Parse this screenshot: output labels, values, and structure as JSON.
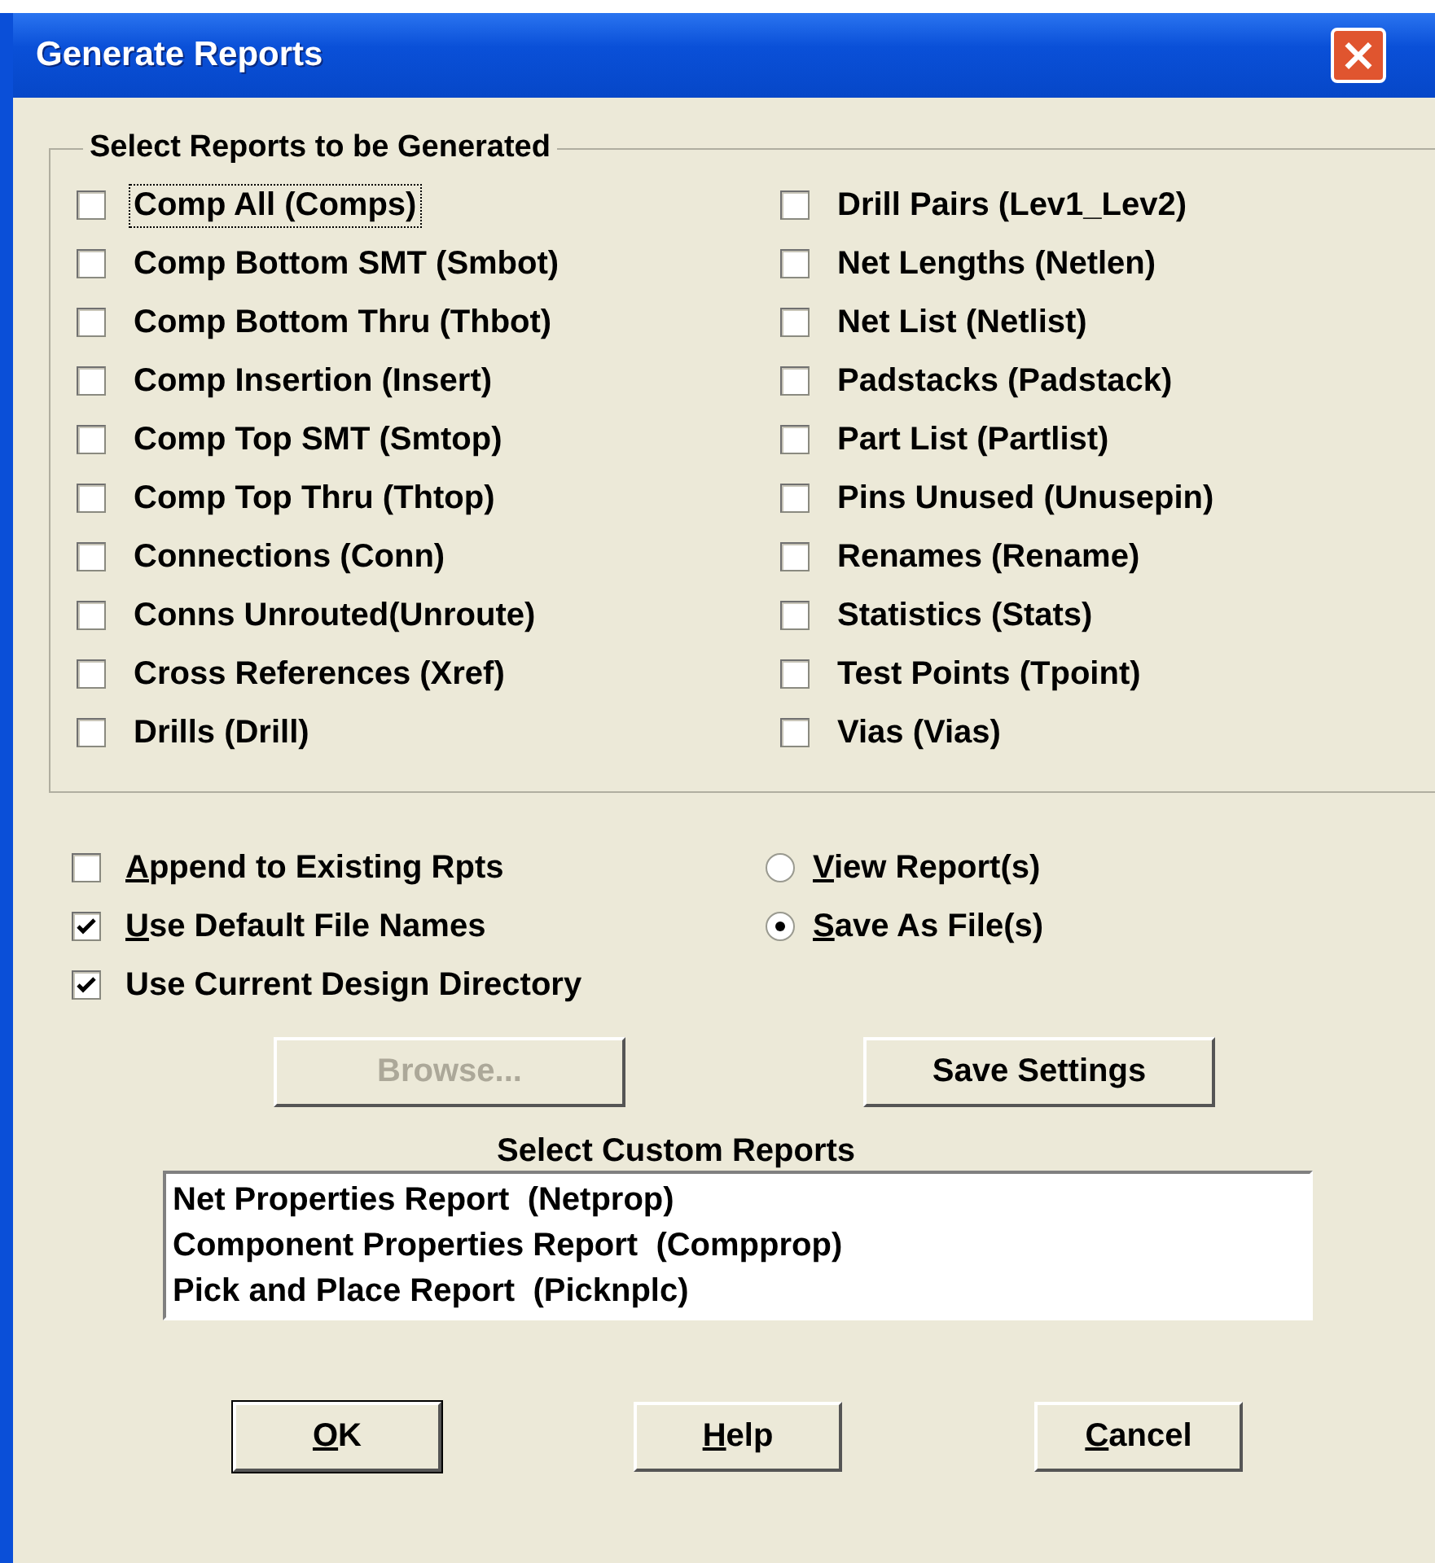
{
  "window": {
    "title": "Generate Reports",
    "close": "×"
  },
  "reports_group": {
    "title": "Select Reports to be Generated",
    "columns": [
      [
        {
          "label": "Comp All (Comps)",
          "checked": false,
          "focused": true
        },
        {
          "label": "Comp Bottom SMT (Smbot)",
          "checked": false,
          "focused": false
        },
        {
          "label": "Comp Bottom Thru (Thbot)",
          "checked": false,
          "focused": false
        },
        {
          "label": "Comp Insertion (Insert)",
          "checked": false,
          "focused": false
        },
        {
          "label": "Comp Top SMT (Smtop)",
          "checked": false,
          "focused": false
        },
        {
          "label": "Comp Top Thru (Thtop)",
          "checked": false,
          "focused": false
        },
        {
          "label": "Connections (Conn)",
          "checked": false,
          "focused": false
        },
        {
          "label": "Conns Unrouted(Unroute)",
          "checked": false,
          "focused": false
        },
        {
          "label": "Cross References (Xref)",
          "checked": false,
          "focused": false
        },
        {
          "label": "Drills (Drill)",
          "checked": false,
          "focused": false
        }
      ],
      [
        {
          "label": "Drill Pairs (Lev1_Lev2)",
          "checked": false,
          "focused": false
        },
        {
          "label": "Net Lengths (Netlen)",
          "checked": false,
          "focused": false
        },
        {
          "label": "Net List (Netlist)",
          "checked": false,
          "focused": false
        },
        {
          "label": "Padstacks (Padstack)",
          "checked": false,
          "focused": false
        },
        {
          "label": "Part List (Partlist)",
          "checked": false,
          "focused": false
        },
        {
          "label": "Pins Unused (Unusepin)",
          "checked": false,
          "focused": false
        },
        {
          "label": "Renames (Rename)",
          "checked": false,
          "focused": false
        },
        {
          "label": "Statistics (Stats)",
          "checked": false,
          "focused": false
        },
        {
          "label": "Test Points (Tpoint)",
          "checked": false,
          "focused": false
        },
        {
          "label": "Vias (Vias)",
          "checked": false,
          "focused": false
        }
      ]
    ]
  },
  "options": [
    {
      "label": "Append to Existing Rpts",
      "checked": false,
      "mnemonic": true
    },
    {
      "label": "Use Default File Names",
      "checked": true,
      "mnemonic": true
    },
    {
      "label": "Use Current Design Directory",
      "checked": true,
      "mnemonic": false
    }
  ],
  "output": [
    {
      "label": "View Report(s)",
      "selected": false,
      "mnemonic": true
    },
    {
      "label": "Save As File(s)",
      "selected": true,
      "mnemonic": true
    }
  ],
  "middle_buttons": [
    {
      "label": "Browse...",
      "disabled": true
    },
    {
      "label": "Save Settings",
      "disabled": false
    }
  ],
  "custom_reports": {
    "title": "Select Custom Reports",
    "items": [
      "Net Properties Report  (Netprop)",
      "Component Properties Report  (Compprop)",
      "Pick and Place Report  (Picknplc)"
    ]
  },
  "buttons": [
    {
      "label": "OK",
      "mnemonic": true,
      "default": true
    },
    {
      "label": "Help",
      "mnemonic": true,
      "default": false
    },
    {
      "label": "Cancel",
      "mnemonic": true,
      "default": false
    }
  ]
}
